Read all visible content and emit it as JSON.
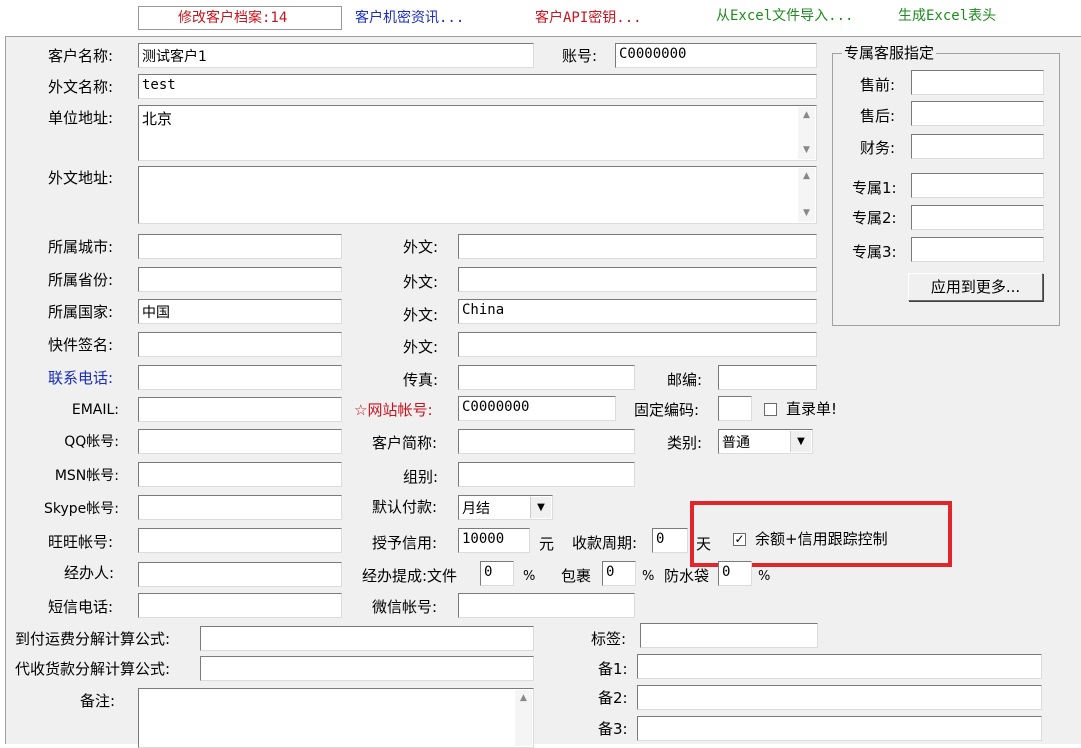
{
  "toolbar": {
    "edit_record": "修改客户档案:14",
    "secret_info": "客户机密资讯...",
    "api_key": "客户API密钥...",
    "import_excel": "从Excel文件导入...",
    "gen_excel": "生成Excel表头"
  },
  "colors": {
    "blue_label": "#1a2dbf",
    "red_label": "#c8141e",
    "green_label": "#1e8c1e",
    "highlight": "#e0262a"
  },
  "fields": {
    "customer_name_label": "客户名称:",
    "customer_name": "测试客户1",
    "account_label": "账号:",
    "account": "C0000000",
    "foreign_name_label": "外文名称:",
    "foreign_name": "test",
    "address_label": "单位地址:",
    "address": "北京",
    "foreign_address_label": "外文地址:",
    "foreign_address": "",
    "city_label": "所属城市:",
    "city": "",
    "province_label": "所属省份:",
    "province": "",
    "country_label": "所属国家:",
    "country": "中国",
    "express_sign_label": "快件签名:",
    "express_sign": "",
    "foreign_label": "外文:",
    "city_foreign": "",
    "province_foreign": "",
    "country_foreign": "China",
    "sign_foreign": "",
    "phone_label": "联系电话:",
    "phone": "",
    "fax_label": "传真:",
    "fax": "",
    "zip_label": "邮编:",
    "zip": "",
    "email_label": "EMAIL:",
    "email": "",
    "website_account_label": "☆网站帐号:",
    "website_account": "C0000000",
    "fixed_code_label": "固定编码:",
    "fixed_code": "",
    "direct_entry_label": "直录单!",
    "direct_entry_checked": false,
    "qq_label": "QQ帐号:",
    "qq": "",
    "short_name_label": "客户简称:",
    "short_name": "",
    "category_label": "类别:",
    "category": "普通",
    "msn_label": "MSN帐号:",
    "msn": "",
    "group_label": "组别:",
    "group": "",
    "skype_label": "Skype帐号:",
    "skype": "",
    "default_payment_label": "默认付款:",
    "default_payment": "月结",
    "wangwang_label": "旺旺帐号:",
    "wangwang": "",
    "credit_label": "授予信用:",
    "credit": "10000",
    "credit_unit": "元",
    "collect_period_label": "收款周期:",
    "collect_period": "0",
    "collect_unit": "天",
    "balance_credit_label": "余额+信用跟踪控制",
    "balance_credit_checked": true,
    "handler_label": "经办人:",
    "handler": "",
    "commission_label": "经办提成:文件",
    "commission_file": "0",
    "percent": "%",
    "parcel_label": "包裹",
    "commission_parcel": "0",
    "waterproof_label": "防水袋",
    "commission_waterproof": "0",
    "sms_label": "短信电话:",
    "sms": "",
    "wechat_label": "微信帐号:",
    "wechat": "",
    "freight_formula_label": "到付运费分解计算公式:",
    "freight_formula": "",
    "cod_formula_label": "代收货款分解计算公式:",
    "cod_formula": "",
    "tag_label": "标签:",
    "tag": "",
    "remark_label": "备注:",
    "remark": "",
    "note1_label": "备1:",
    "note1": "",
    "note2_label": "备2:",
    "note2": "",
    "note3_label": "备3:",
    "note3": ""
  },
  "service": {
    "title": "专属客服指定",
    "presale_label": "售前:",
    "presale": "",
    "aftersale_label": "售后:",
    "aftersale": "",
    "finance_label": "财务:",
    "finance": "",
    "exclusive1_label": "专属1:",
    "exclusive1": "",
    "exclusive2_label": "专属2:",
    "exclusive2": "",
    "exclusive3_label": "专属3:",
    "exclusive3": "",
    "apply_more": "应用到更多..."
  }
}
